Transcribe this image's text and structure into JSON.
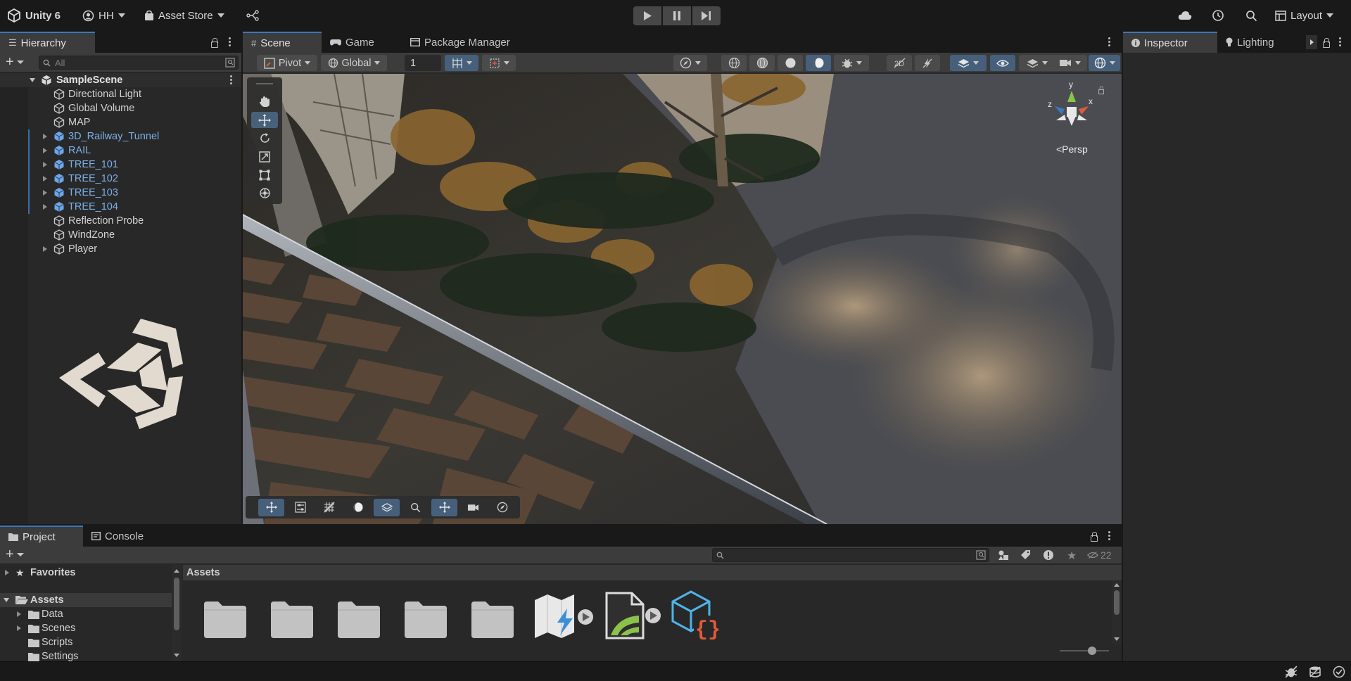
{
  "topbar": {
    "app_title": "Unity 6",
    "account_label": "HH",
    "asset_store_label": "Asset Store",
    "layout_label": "Layout"
  },
  "hierarchy": {
    "tab_label": "Hierarchy",
    "search_placeholder": "All",
    "scene_name": "SampleScene",
    "items": [
      {
        "label": "Directional Light",
        "prefab": false,
        "expandable": false
      },
      {
        "label": "Global Volume",
        "prefab": false,
        "expandable": false
      },
      {
        "label": "MAP",
        "prefab": false,
        "expandable": false
      },
      {
        "label": "3D_Railway_Tunnel",
        "prefab": true,
        "expandable": true
      },
      {
        "label": "RAIL",
        "prefab": true,
        "expandable": true
      },
      {
        "label": "TREE_101",
        "prefab": true,
        "expandable": true
      },
      {
        "label": "TREE_102",
        "prefab": true,
        "expandable": true
      },
      {
        "label": "TREE_103",
        "prefab": true,
        "expandable": true
      },
      {
        "label": "TREE_104",
        "prefab": true,
        "expandable": true
      },
      {
        "label": "Reflection Probe",
        "prefab": false,
        "expandable": false
      },
      {
        "label": "WindZone",
        "prefab": false,
        "expandable": false
      },
      {
        "label": "Player",
        "prefab": false,
        "expandable": true
      }
    ]
  },
  "center_tabs": {
    "scene": "Scene",
    "game": "Game",
    "package_manager": "Package Manager"
  },
  "scene_toolbar": {
    "pivot_label": "Pivot",
    "global_label": "Global",
    "grid_snap_value": "1"
  },
  "scene_view": {
    "gizmo_y": "y",
    "gizmo_x": "x",
    "gizmo_z": "z",
    "projection_label": "<Persp"
  },
  "right_tabs": {
    "inspector": "Inspector",
    "lighting": "Lighting"
  },
  "bottom_tabs": {
    "project": "Project",
    "console": "Console"
  },
  "project": {
    "favorites_label": "Favorites",
    "assets_label": "Assets",
    "tree_children": [
      "Data",
      "Scenes",
      "Scripts",
      "Settings"
    ],
    "assets_header": "Assets",
    "hidden_count": "22"
  },
  "colors": {
    "accent_blue": "#3a79bb",
    "prefab_text": "#7bafe8",
    "selected_button": "#46607c",
    "panel_bg": "#282828"
  }
}
